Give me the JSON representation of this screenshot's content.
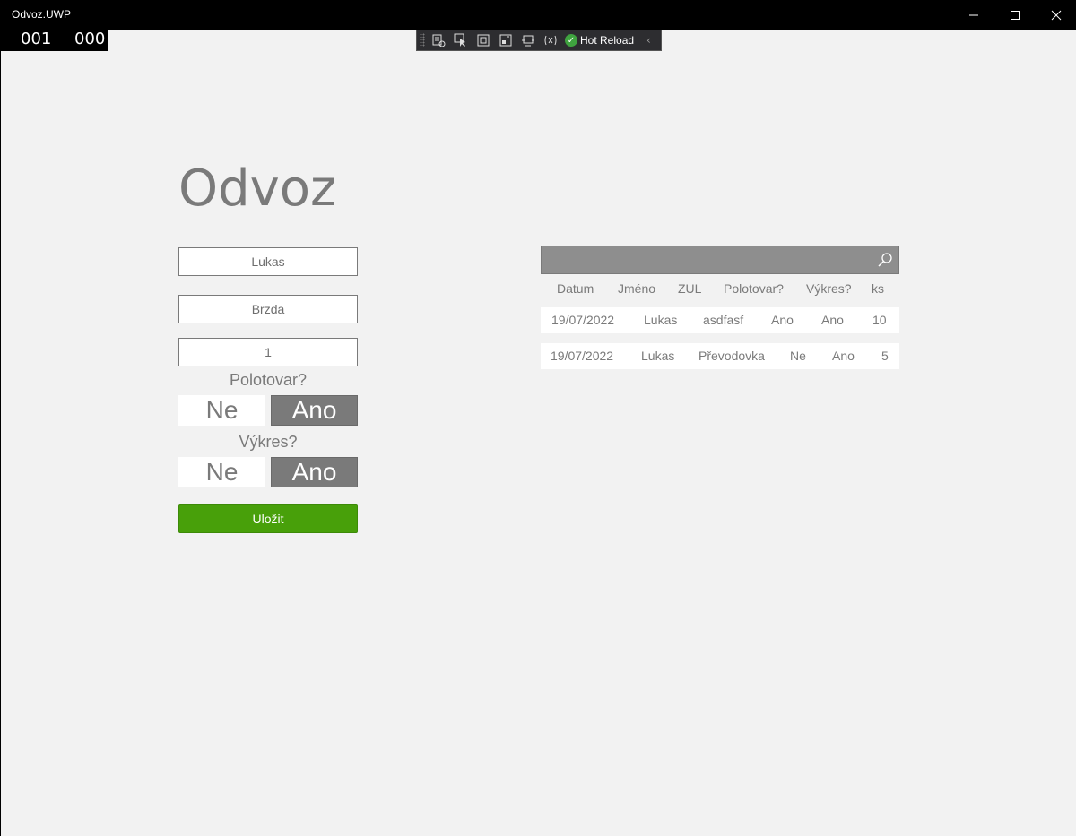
{
  "window": {
    "title": "Odvoz.UWP",
    "minimize_icon": "minimize-icon",
    "maximize_icon": "maximize-icon",
    "close_icon": "close-icon"
  },
  "frame_counter": {
    "left": "001",
    "right": "000"
  },
  "dev_toolbar": {
    "tools": [
      "live-visual-tree-icon",
      "select-element-icon",
      "display-layout-adorners-icon",
      "track-focus-icon",
      "binding-failures-icon",
      "toggle-theme-icon"
    ],
    "hot_reload_label": "Hot Reload",
    "collapse_icon": "chevron-left-icon"
  },
  "page": {
    "heading": "Odvoz",
    "name_value": "Lukas",
    "part_value": "Brzda",
    "count_value": "1",
    "semi_product_label": "Polotovar?",
    "drawing_label": "Výkres?",
    "no_label": "Ne",
    "yes_label": "Ano",
    "save_label": "Uložit"
  },
  "search": {
    "value": "",
    "icon": "search-icon"
  },
  "table": {
    "headers": [
      "Datum",
      "Jméno",
      "ZUL",
      "Polotovar?",
      "Výkres?",
      "ks"
    ],
    "rows": [
      [
        "19/07/2022",
        "Lukas",
        "asdfasf",
        "Ano",
        "Ano",
        "10"
      ],
      [
        "19/07/2022",
        "Lukas",
        "Převodovka",
        "Ne",
        "Ano",
        "5"
      ]
    ]
  },
  "colors": {
    "background": "#f2f2f2",
    "accent_green": "#48a00a",
    "toggle_active": "#7a7a7a",
    "text_gray": "#7a7a7a"
  }
}
